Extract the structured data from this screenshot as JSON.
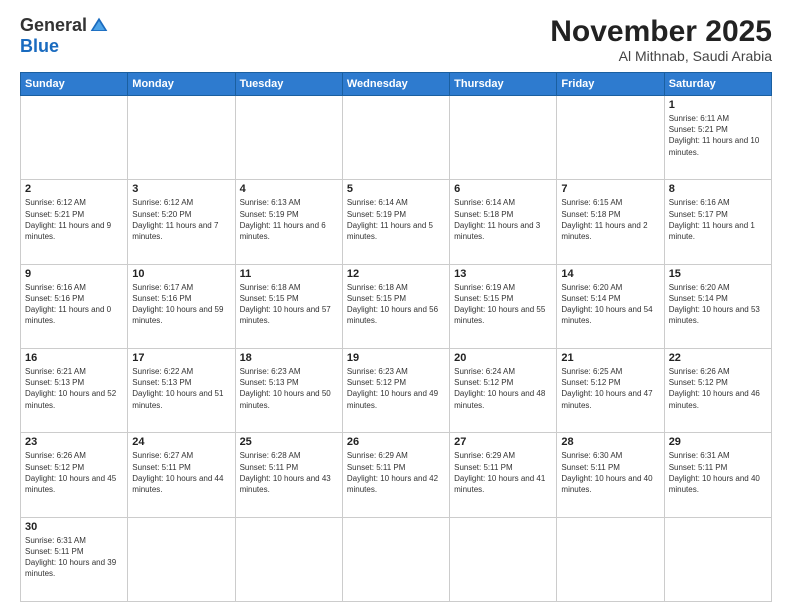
{
  "logo": {
    "general": "General",
    "blue": "Blue"
  },
  "header": {
    "month": "November 2025",
    "location": "Al Mithnab, Saudi Arabia"
  },
  "weekdays": [
    "Sunday",
    "Monday",
    "Tuesday",
    "Wednesday",
    "Thursday",
    "Friday",
    "Saturday"
  ],
  "days": {
    "1": {
      "sunrise": "6:11 AM",
      "sunset": "5:21 PM",
      "daylight": "11 hours and 10 minutes."
    },
    "2": {
      "sunrise": "6:12 AM",
      "sunset": "5:21 PM",
      "daylight": "11 hours and 9 minutes."
    },
    "3": {
      "sunrise": "6:12 AM",
      "sunset": "5:20 PM",
      "daylight": "11 hours and 7 minutes."
    },
    "4": {
      "sunrise": "6:13 AM",
      "sunset": "5:19 PM",
      "daylight": "11 hours and 6 minutes."
    },
    "5": {
      "sunrise": "6:14 AM",
      "sunset": "5:19 PM",
      "daylight": "11 hours and 5 minutes."
    },
    "6": {
      "sunrise": "6:14 AM",
      "sunset": "5:18 PM",
      "daylight": "11 hours and 3 minutes."
    },
    "7": {
      "sunrise": "6:15 AM",
      "sunset": "5:18 PM",
      "daylight": "11 hours and 2 minutes."
    },
    "8": {
      "sunrise": "6:16 AM",
      "sunset": "5:17 PM",
      "daylight": "11 hours and 1 minute."
    },
    "9": {
      "sunrise": "6:16 AM",
      "sunset": "5:16 PM",
      "daylight": "11 hours and 0 minutes."
    },
    "10": {
      "sunrise": "6:17 AM",
      "sunset": "5:16 PM",
      "daylight": "10 hours and 59 minutes."
    },
    "11": {
      "sunrise": "6:18 AM",
      "sunset": "5:15 PM",
      "daylight": "10 hours and 57 minutes."
    },
    "12": {
      "sunrise": "6:18 AM",
      "sunset": "5:15 PM",
      "daylight": "10 hours and 56 minutes."
    },
    "13": {
      "sunrise": "6:19 AM",
      "sunset": "5:15 PM",
      "daylight": "10 hours and 55 minutes."
    },
    "14": {
      "sunrise": "6:20 AM",
      "sunset": "5:14 PM",
      "daylight": "10 hours and 54 minutes."
    },
    "15": {
      "sunrise": "6:20 AM",
      "sunset": "5:14 PM",
      "daylight": "10 hours and 53 minutes."
    },
    "16": {
      "sunrise": "6:21 AM",
      "sunset": "5:13 PM",
      "daylight": "10 hours and 52 minutes."
    },
    "17": {
      "sunrise": "6:22 AM",
      "sunset": "5:13 PM",
      "daylight": "10 hours and 51 minutes."
    },
    "18": {
      "sunrise": "6:23 AM",
      "sunset": "5:13 PM",
      "daylight": "10 hours and 50 minutes."
    },
    "19": {
      "sunrise": "6:23 AM",
      "sunset": "5:12 PM",
      "daylight": "10 hours and 49 minutes."
    },
    "20": {
      "sunrise": "6:24 AM",
      "sunset": "5:12 PM",
      "daylight": "10 hours and 48 minutes."
    },
    "21": {
      "sunrise": "6:25 AM",
      "sunset": "5:12 PM",
      "daylight": "10 hours and 47 minutes."
    },
    "22": {
      "sunrise": "6:26 AM",
      "sunset": "5:12 PM",
      "daylight": "10 hours and 46 minutes."
    },
    "23": {
      "sunrise": "6:26 AM",
      "sunset": "5:12 PM",
      "daylight": "10 hours and 45 minutes."
    },
    "24": {
      "sunrise": "6:27 AM",
      "sunset": "5:11 PM",
      "daylight": "10 hours and 44 minutes."
    },
    "25": {
      "sunrise": "6:28 AM",
      "sunset": "5:11 PM",
      "daylight": "10 hours and 43 minutes."
    },
    "26": {
      "sunrise": "6:29 AM",
      "sunset": "5:11 PM",
      "daylight": "10 hours and 42 minutes."
    },
    "27": {
      "sunrise": "6:29 AM",
      "sunset": "5:11 PM",
      "daylight": "10 hours and 41 minutes."
    },
    "28": {
      "sunrise": "6:30 AM",
      "sunset": "5:11 PM",
      "daylight": "10 hours and 40 minutes."
    },
    "29": {
      "sunrise": "6:31 AM",
      "sunset": "5:11 PM",
      "daylight": "10 hours and 40 minutes."
    },
    "30": {
      "sunrise": "6:31 AM",
      "sunset": "5:11 PM",
      "daylight": "10 hours and 39 minutes."
    }
  },
  "labels": {
    "sunrise": "Sunrise:",
    "sunset": "Sunset:",
    "daylight": "Daylight:"
  }
}
